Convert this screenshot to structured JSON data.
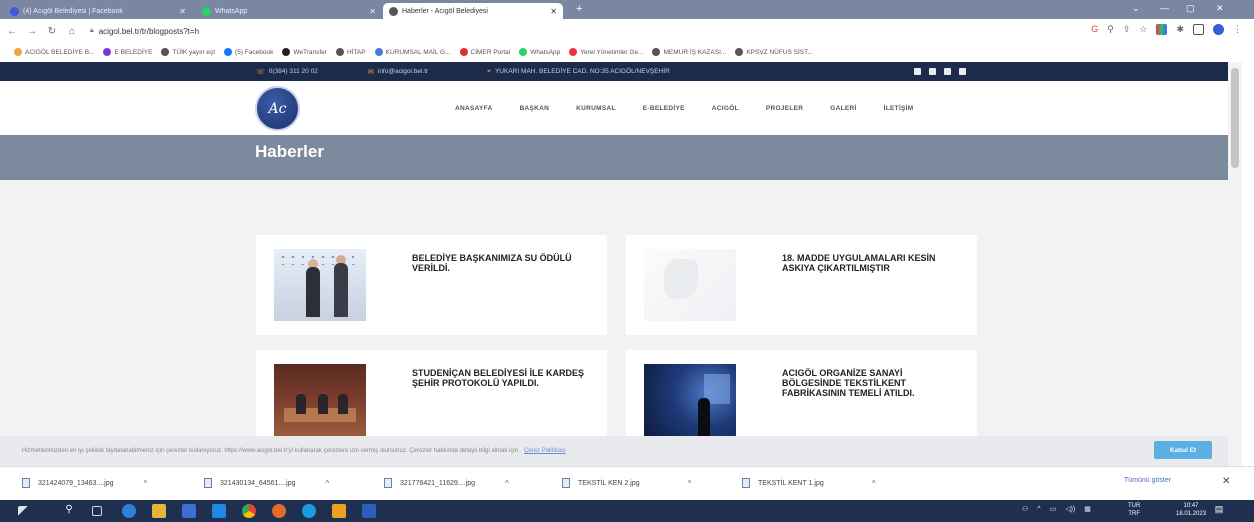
{
  "browser": {
    "tabs": [
      {
        "title": "(4) Acıgöl Belediyesi | Facebook",
        "favicon_color": "#3b5bdb"
      },
      {
        "title": "WhatsApp",
        "favicon_color": "#25d366"
      },
      {
        "title": "Haberler - Acıgöl Belediyesi",
        "favicon_color": "#555555"
      }
    ],
    "url": "acigol.bel.tr/tr/blogposts?t=h",
    "bookmarks": [
      "ACIGÖL BELEDİYE B...",
      "E BELEDİYE",
      "TÜİK yayın eşt",
      "(5) Facebook",
      "WeTransfer",
      "HİTAP",
      "KURUMSAL MAİL G...",
      "CİMER Portal",
      "WhatsApp",
      "Yerel Yönetimler Ge...",
      "MEMUR İŞ KAZASI...",
      "KPSVZ NÜFUS SİST..."
    ]
  },
  "site": {
    "phone": "0(384) 311 20 02",
    "email": "info@acigol.bel.tr",
    "address": "YUKARI MAH. BELEDİYE CAD. NO:35 ACIGÖL/NEVŞEHİR",
    "nav": [
      "ANASAYFA",
      "BAŞKAN",
      "KURUMSAL",
      "E-BELEDİYE",
      "ACIGÖL",
      "PROJELER",
      "GALERİ",
      "İLETİŞİM"
    ],
    "page_title": "Haberler",
    "news": [
      {
        "title": "BELEDİYE BAŞKANIMIZA SU ÖDÜLÜ VERİLDİ."
      },
      {
        "title": "18. MADDE UYGULAMALARI KESİN ASKIYA ÇIKARTILMIŞTIR"
      },
      {
        "title": "STUDENİÇAN BELEDİYESİ İLE KARDEŞ ŞEHİR PROTOKOLÜ YAPILDI."
      },
      {
        "title": "ACIGÖL ORGANİZE SANAYİ BÖLGESİNDE TEKSTİLKENT FABRİKASININ TEMELİ ATILDI."
      }
    ],
    "cookie": {
      "text": "Hizmetlerimizden en iyi şekilde faydalanabilmeniz için çerezler kullanıyoruz. https://www.acigol.bel.tr'yi kullanarak çerezlere izin vermiş olursunuz. Çerezler hakkında detaylı bilgi almak için",
      "link": "Çerez Politikası",
      "accept": "Kabul Et"
    }
  },
  "downloads": {
    "items": [
      "321424079_13463....jpg",
      "321430134_64561....jpg",
      "321776421_11629....jpg",
      "TEKSTİL KEN 2.jpg",
      "TEKSTİL KENT 1.jpg"
    ],
    "show_all": "Tümünü göster"
  },
  "taskbar": {
    "lang_top": "TUR",
    "lang_bottom": "TRF",
    "time": "10:47",
    "date": "18.01.2023"
  },
  "colors": {
    "topbar": "#1d2b4a",
    "banner": "#7c8a9d",
    "accent": "#5bb0e3"
  }
}
